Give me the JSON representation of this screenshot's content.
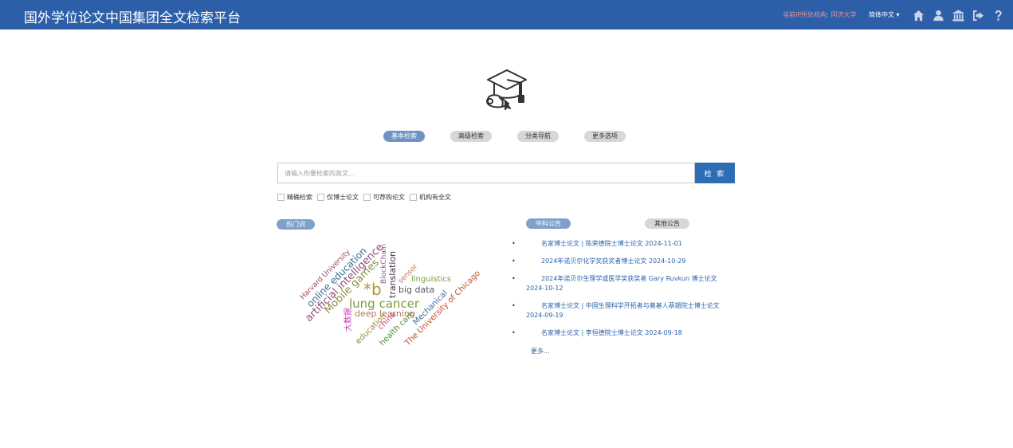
{
  "header": {
    "title": "国外学位论文中国集团全文检索平台",
    "ip_institution": "当前IP所处机构: 同济大学",
    "language": "简体中文",
    "icons": [
      "home-icon",
      "user-icon",
      "institution-icon",
      "logout-icon",
      "help-icon"
    ]
  },
  "search_tabs": {
    "basic": "基本检索",
    "advanced": "高级检索",
    "category": "分类导航",
    "more_options": "更多选项"
  },
  "search": {
    "placeholder": "请输入你要检索的英文...",
    "button_label": "检 索"
  },
  "options": {
    "exact": "精确检索",
    "phd_only": "仅博士论文",
    "purchasable": "可荐购论文",
    "institution_fulltext": "机构有全文"
  },
  "hot_words": {
    "label": "热门词",
    "words": [
      "lung cancer",
      "*b",
      "big data",
      "linguistics",
      "deep learning",
      "Mobile games",
      "artificial intelligence",
      "online education",
      "Harvard University",
      "translation",
      "BlockChain",
      "sensor",
      "Mechanical",
      "The University of Chicago",
      "health care",
      "china",
      "education",
      "大数据"
    ]
  },
  "notices": {
    "tab_active": "中科公告",
    "tab_other": "其他公告",
    "items": [
      "名家博士论文 | 陈荣德院士博士论文  2024-11-01",
      "2024年诺贝尔化学奖获奖者博士论文  2024-10-29",
      "2024年诺贝尔生理学或医学奖获奖者 Gary Ruvkun 博士论文  2024-10-12",
      "名家博士论文 | 中国生理科学开拓者与奠基人蔡翘院士博士论文  2024-09-19",
      "名家博士论文 | 李恒德院士博士论文  2024-09-18"
    ],
    "more": "更多..."
  },
  "colors": {
    "header_bg": "#2d5fa8",
    "accent_button": "#2d6db4",
    "active_tab": "#6f93c4",
    "inactive_tab": "#d7d7d7",
    "link": "#2a63a8",
    "ip_text": "#f28f8f"
  }
}
